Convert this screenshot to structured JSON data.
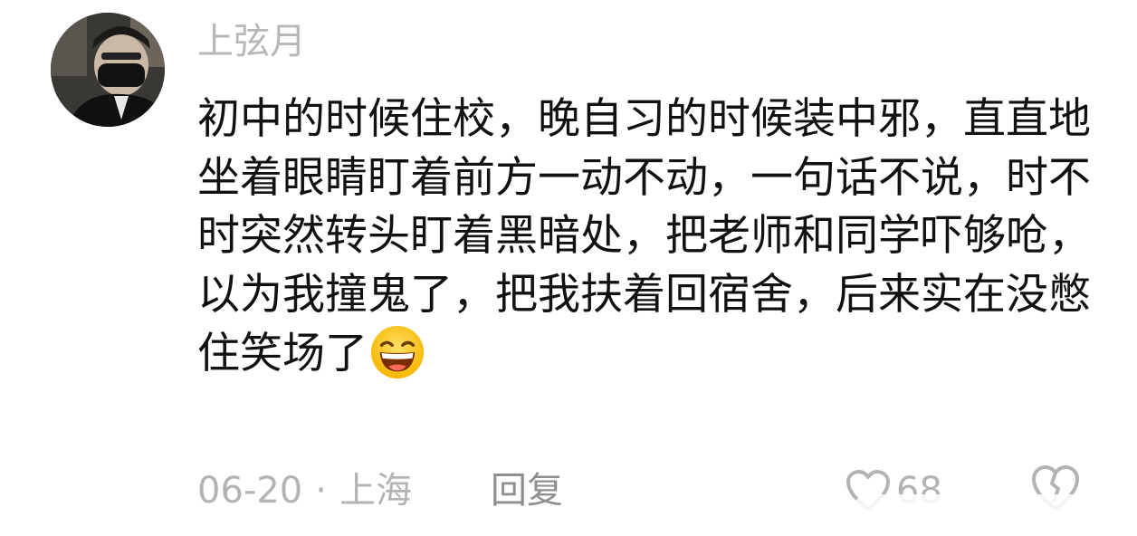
{
  "comment": {
    "username": "上弦月",
    "text": "初中的时候住校，晚自习的时候装中邪，直直地坐着眼睛盯着前方一动不动，一句话不说，时不时突然转头盯着黑暗处，把老师和同学吓够呛，以为我撞鬼了，把我扶着回宿舍，后来实在没憋住笑场了",
    "emoji_icon": "grinning-face-emoji-icon",
    "date": "06-20",
    "separator": "·",
    "location": "上海",
    "reply_label": "回复",
    "like_count": "68"
  },
  "colors": {
    "text": "#111111",
    "muted": "#b3b3b3",
    "reply": "#8f8f8f"
  }
}
